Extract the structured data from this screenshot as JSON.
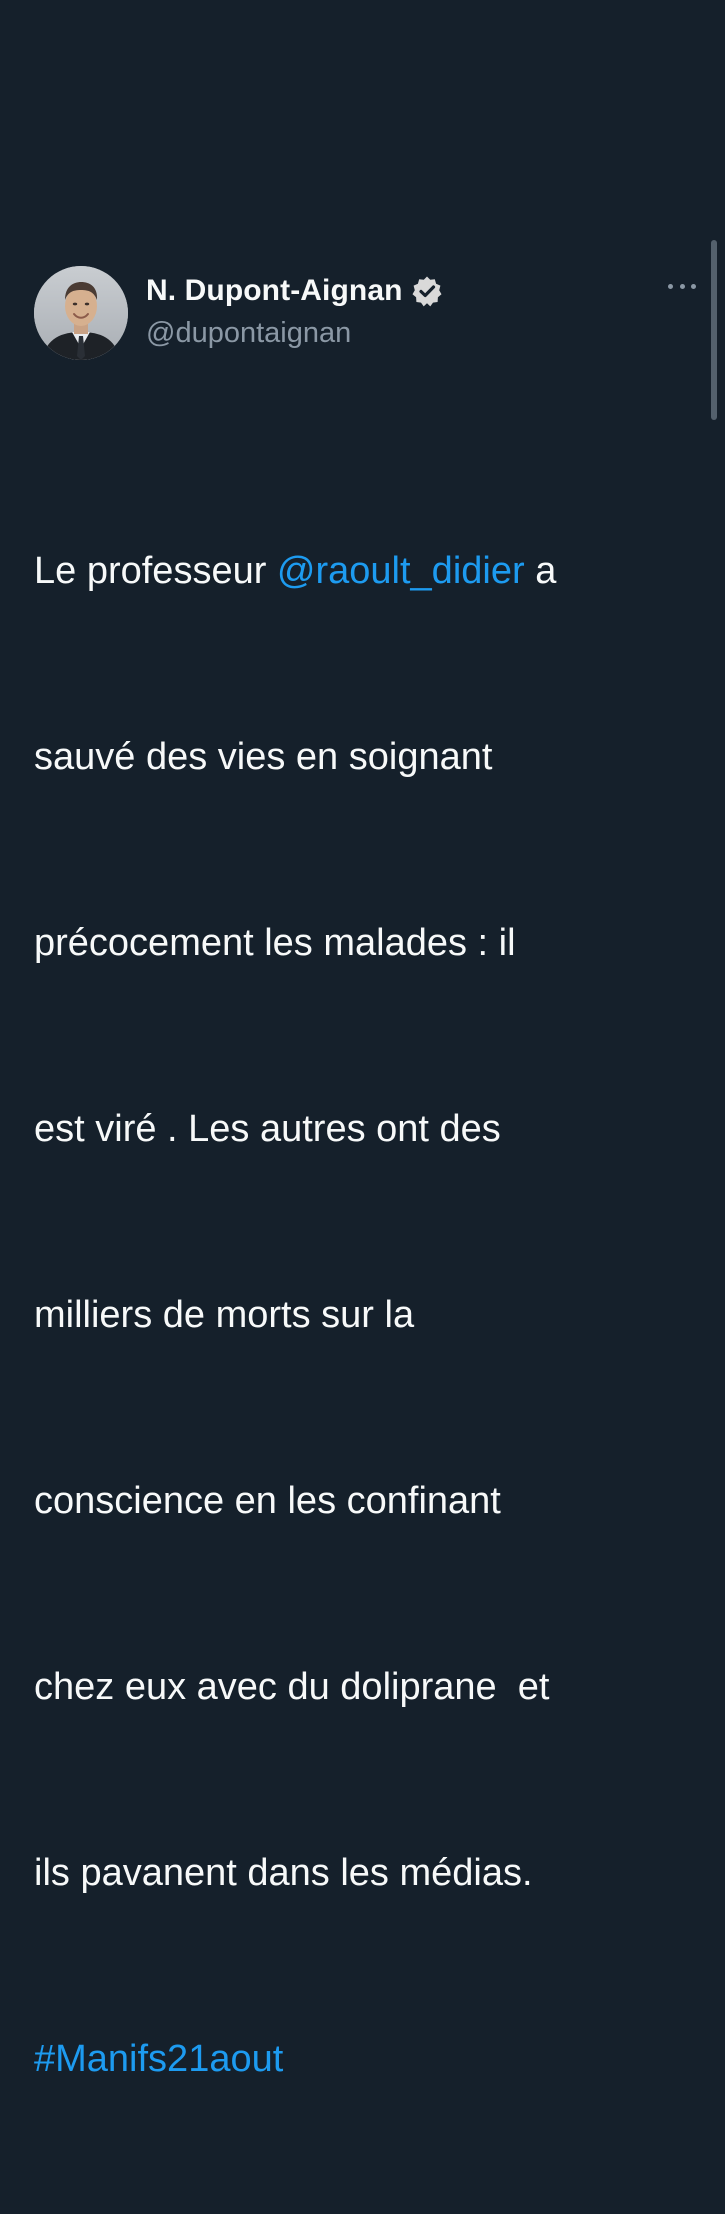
{
  "tweet": {
    "author": {
      "display_name": "N. Dupont-Aignan",
      "handle": "@dupontaignan",
      "verified": true,
      "avatar_icon": "profile-photo"
    },
    "more_icon": "more-horizontal-icon",
    "verified_icon": "verified-badge-icon",
    "text_lines": [
      {
        "before": "Le professeur ",
        "mention": "@raoult_didier",
        "after": " a"
      },
      {
        "text": "sauvé des vies en soignant"
      },
      {
        "text": "précocement les malades : il"
      },
      {
        "text": "est viré . Les autres ont des"
      },
      {
        "text": "milliers de morts sur la"
      },
      {
        "text": "conscience en les confinant"
      },
      {
        "text": "chez eux avec du doliprane  et"
      },
      {
        "text": "ils pavanent dans les médias."
      },
      {
        "hashtag": "#Manifs21aout"
      }
    ]
  },
  "colors": {
    "background": "#15202b",
    "link": "#1d9bf0",
    "text": "#f7f9f9",
    "secondary_text": "#8b98a5"
  }
}
